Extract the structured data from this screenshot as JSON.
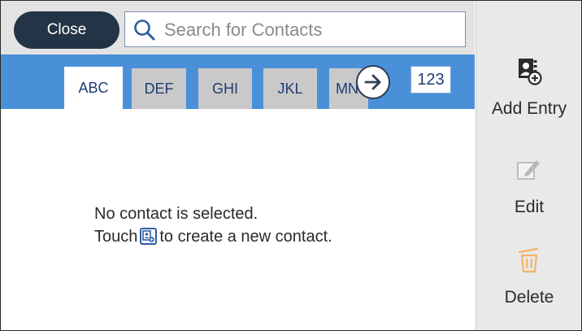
{
  "header": {
    "close_label": "Close",
    "search_placeholder": "Search for Contacts"
  },
  "tabs": [
    {
      "label": "ABC",
      "active": true
    },
    {
      "label": "DEF",
      "active": false
    },
    {
      "label": "GHI",
      "active": false
    },
    {
      "label": "JKL",
      "active": false
    },
    {
      "label": "MNO",
      "active": false
    }
  ],
  "numeric_tab": "123",
  "message": {
    "line1": "No contact is selected.",
    "line2_prefix": "Touch",
    "line2_suffix": "to create a new contact."
  },
  "sidebar": {
    "add_entry": "Add Entry",
    "edit": "Edit",
    "delete": "Delete"
  },
  "colors": {
    "accent_blue": "#4a90d9",
    "close_button": "#243447",
    "delete_icon": "#e8a04a"
  }
}
